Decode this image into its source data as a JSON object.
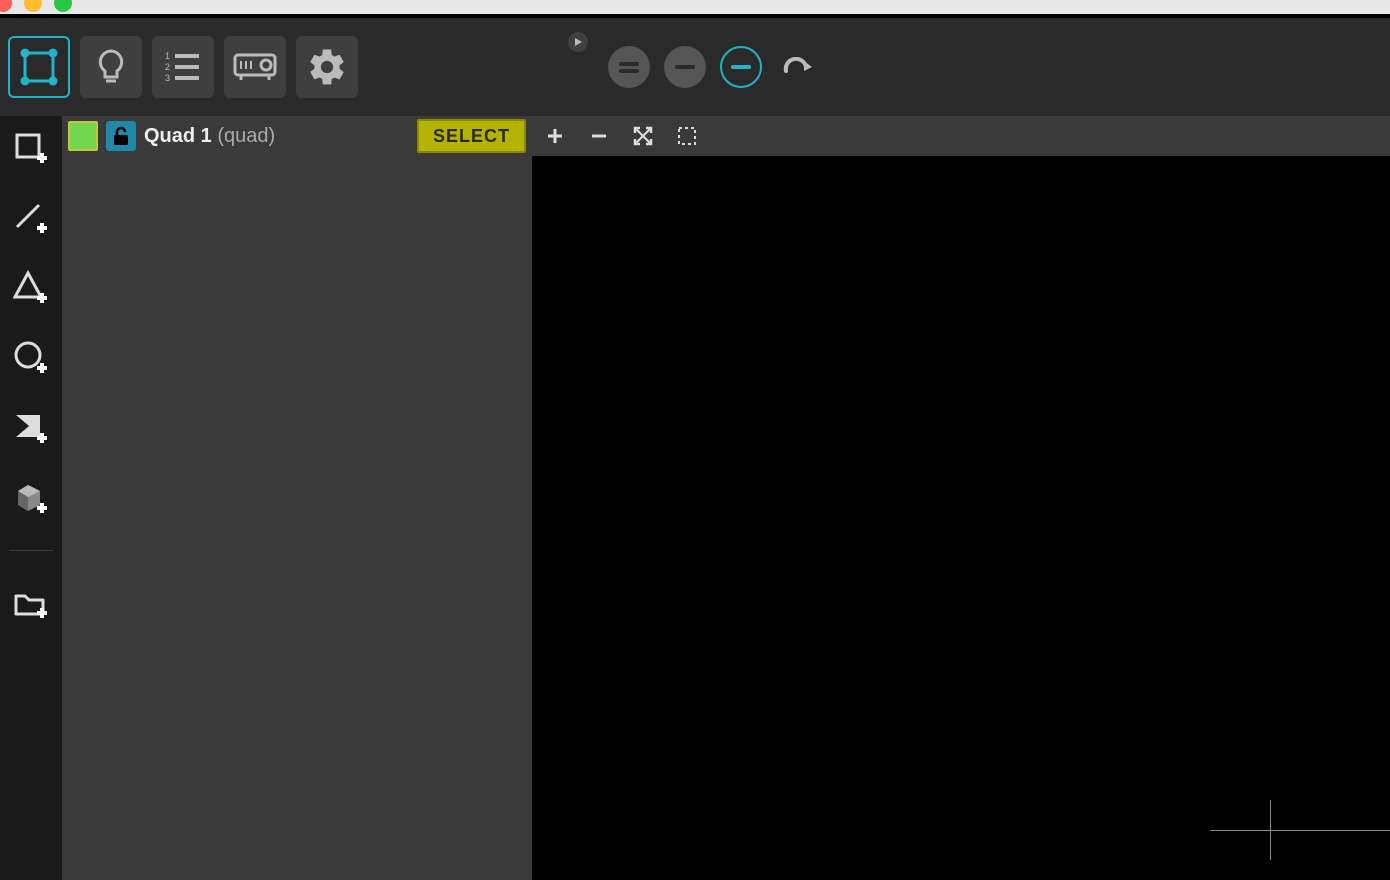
{
  "window": {
    "traffic": [
      "close",
      "minimize",
      "zoom"
    ]
  },
  "topbar": {
    "modes": [
      {
        "name": "mapping-mode",
        "active": true,
        "icon": "mapping"
      },
      {
        "name": "light-mode",
        "active": false,
        "icon": "bulb"
      },
      {
        "name": "list-mode",
        "active": false,
        "icon": "numbered-list"
      },
      {
        "name": "projector-mode",
        "active": false,
        "icon": "projector"
      },
      {
        "name": "settings-mode",
        "active": false,
        "icon": "gear"
      }
    ],
    "play_icon": "play",
    "circles": [
      {
        "name": "equal-circle",
        "style": "solid",
        "icon": "equals"
      },
      {
        "name": "minus-solid-circle",
        "style": "solid",
        "icon": "minus"
      },
      {
        "name": "minus-outline-circle",
        "style": "outline",
        "icon": "minus-cyan"
      },
      {
        "name": "redo-circle",
        "style": "ghost",
        "icon": "redo"
      }
    ]
  },
  "leftTools": [
    {
      "name": "add-rectangle-tool",
      "icon": "rect-plus"
    },
    {
      "name": "add-line-tool",
      "icon": "line-plus"
    },
    {
      "name": "add-triangle-tool",
      "icon": "triangle-plus"
    },
    {
      "name": "add-ellipse-tool",
      "icon": "ellipse-plus"
    },
    {
      "name": "add-mask-tool",
      "icon": "mask-plus"
    },
    {
      "name": "add-cube-tool",
      "icon": "cube-plus"
    },
    {
      "name": "add-folder-tool",
      "icon": "folder-plus"
    }
  ],
  "layer": {
    "swatch_color": "#6fd64f",
    "locked": false,
    "name": "Quad 1",
    "type": "(quad)",
    "select_label": "SELECT"
  },
  "canvasTools": [
    {
      "name": "zoom-in-tool",
      "icon": "plus"
    },
    {
      "name": "zoom-out-tool",
      "icon": "minus"
    },
    {
      "name": "fit-screen-tool",
      "icon": "expand"
    },
    {
      "name": "selection-rect-tool",
      "icon": "dashed-rect"
    }
  ]
}
